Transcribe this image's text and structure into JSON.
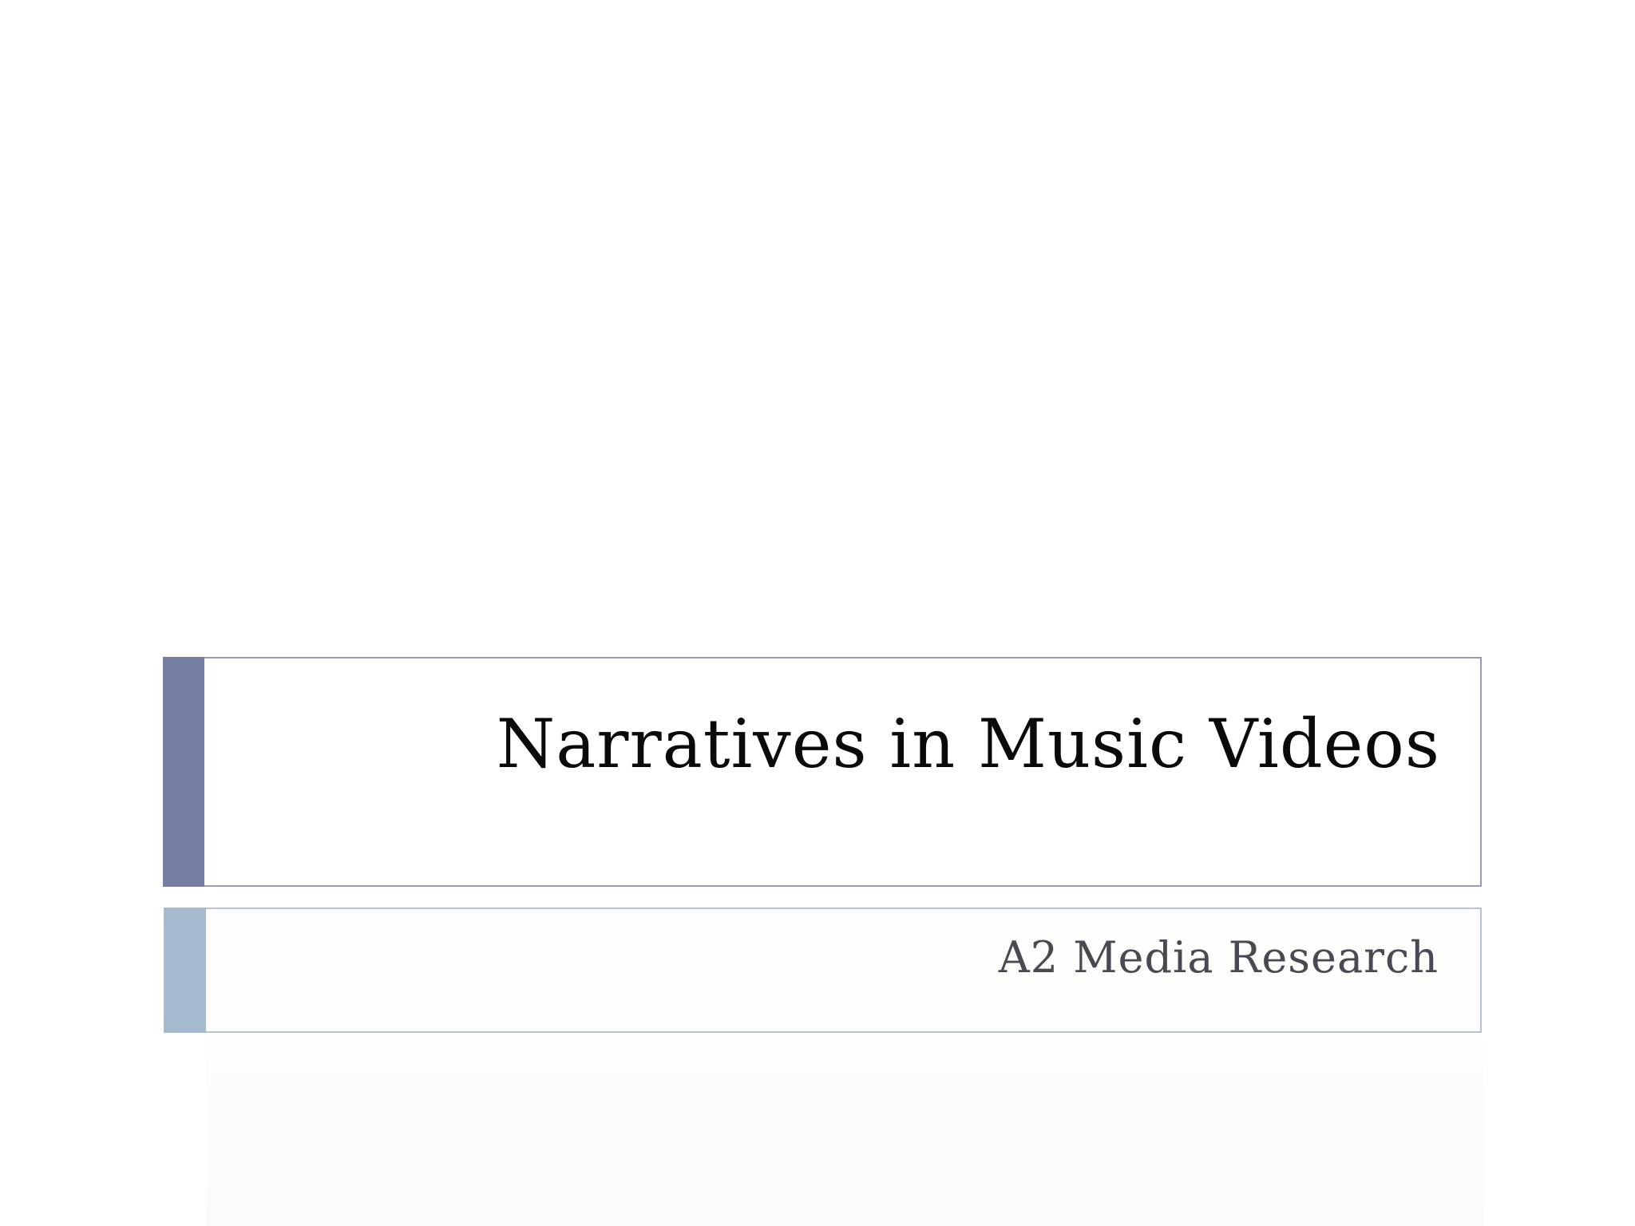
{
  "slide": {
    "title": "Narratives in Music Videos",
    "subtitle": "A2 Media Research"
  },
  "colors": {
    "title_accent": "#757da3",
    "title_border": "#9a9ab8",
    "subtitle_accent": "#a3bacf",
    "subtitle_border": "#b7c4d6",
    "title_text": "#0a0a0a",
    "subtitle_text": "#4a4850"
  }
}
